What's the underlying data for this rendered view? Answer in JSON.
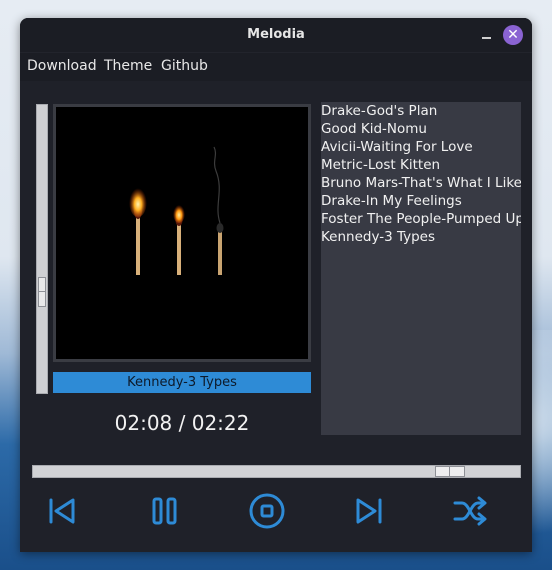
{
  "window": {
    "title": "Melodia"
  },
  "menu": {
    "items": [
      "Download",
      "Theme",
      "Github"
    ]
  },
  "player": {
    "now_playing": "Kennedy-3 Types",
    "time": "02:08 / 02:22"
  },
  "playlist": [
    "Drake-God's Plan",
    "Good Kid-Nomu",
    "Avicii-Waiting For Love",
    "Metric-Lost Kitten",
    "Bruno Mars-That's What I Like",
    "Drake-In My Feelings",
    "Foster The People-Pumped Up",
    "Kennedy-3 Types"
  ],
  "progress": {
    "seek_fraction": 0.88
  },
  "controls": [
    "previous-icon",
    "pause-icon",
    "stop-icon",
    "next-icon",
    "shuffle-icon"
  ],
  "colors": {
    "accent": "#2e8bd6",
    "close_button": "#8a63d2",
    "window_bg": "#1f2129",
    "playlist_bg": "#383a44"
  }
}
